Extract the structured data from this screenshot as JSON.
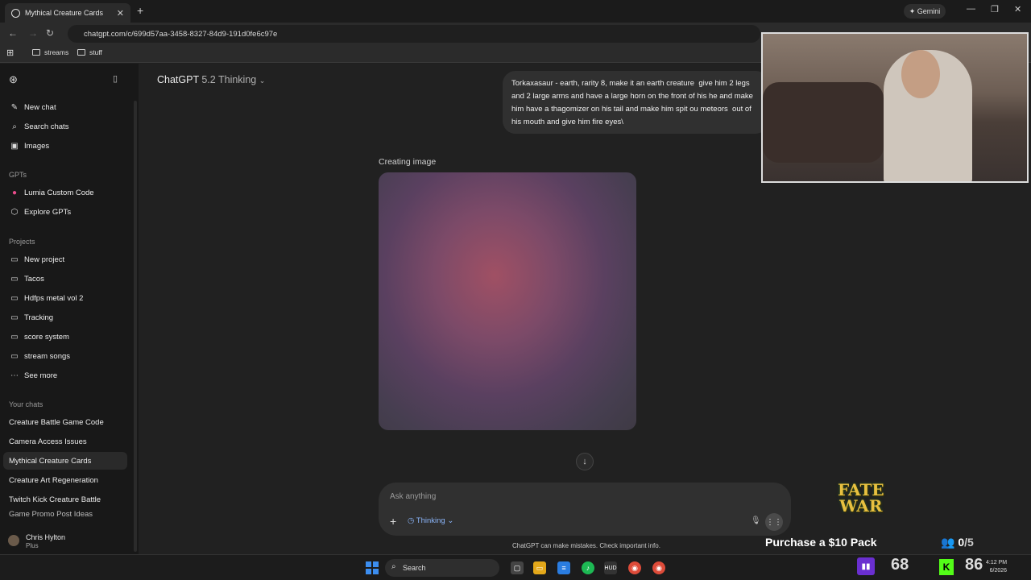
{
  "browser": {
    "tab_title": "Mythical Creature Cards",
    "gemini_label": "Gemini",
    "url": "chatgpt.com/c/699d57aa-3458-8327-84d9-191d0fe6c97e",
    "bookmarks": [
      "streams",
      "stuff"
    ]
  },
  "sidebar": {
    "top_items": [
      "New chat",
      "Search chats",
      "Images"
    ],
    "gpts_heading": "GPTs",
    "gpts": [
      "Lumia Custom Code",
      "Explore GPTs"
    ],
    "projects_heading": "Projects",
    "projects": [
      "New project",
      "Tacos",
      "Hdfps metal vol 2",
      "Tracking",
      "score system",
      "stream songs",
      "See more"
    ],
    "chats_heading": "Your chats",
    "chats": [
      "Creature Battle Game Code",
      "Camera Access Issues",
      "Mythical Creature Cards",
      "Creature Art Regeneration",
      "Twitch Kick Creature Battle",
      "Game Promo Post Ideas"
    ],
    "user_name": "Chris Hylton",
    "user_plan": "Plus"
  },
  "main": {
    "model_name": "ChatGPT",
    "model_version": "5.2 Thinking",
    "user_message": "Torkaxasaur - earth, rarity 8, make it an earth creature  give him 2 legs and 2 large arms and have a large horn on the front of his he and make him have a thagomizer on his tail and make him spit ou meteors  out of his mouth and give him fire eyes\\",
    "creating_label": "Creating image",
    "composer_placeholder": "Ask anything",
    "thinking_label": "Thinking",
    "disclaimer": "ChatGPT can make mistakes. Check important info."
  },
  "overlay": {
    "logo_line1": "FATE",
    "logo_line2": "WAR",
    "purchase_text": "Purchase a $10 Pack",
    "players_current": "0",
    "players_total": "/5",
    "twitch_score": "68",
    "kick_score": "86"
  },
  "taskbar": {
    "search_label": "Search",
    "time": "4:12 PM",
    "date": "6/2026"
  }
}
